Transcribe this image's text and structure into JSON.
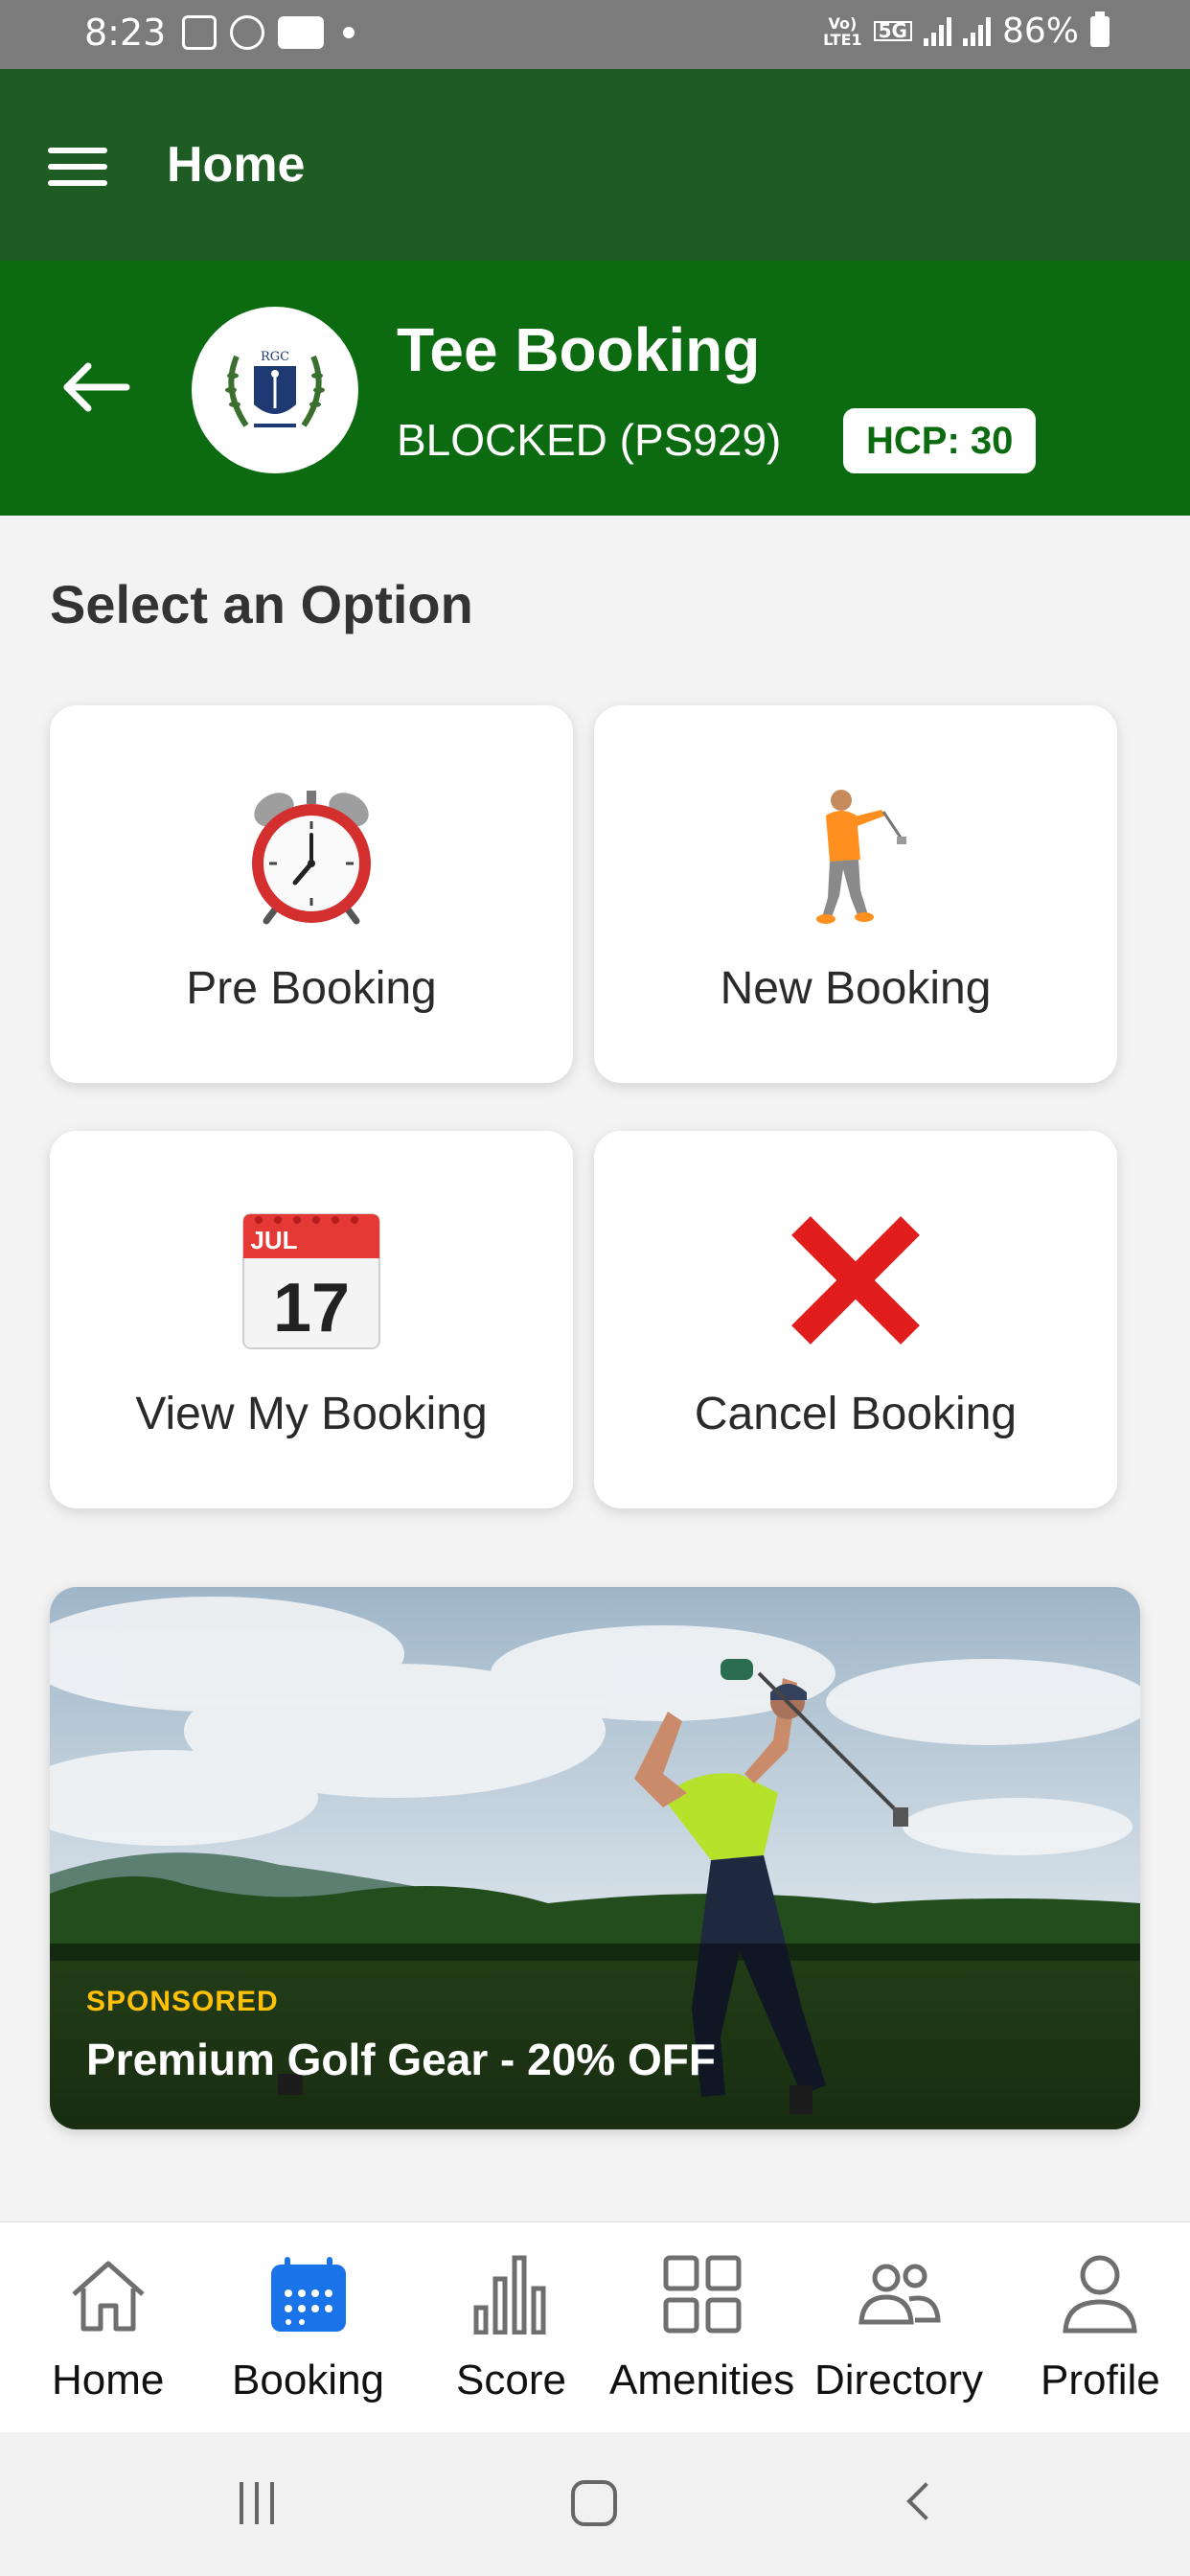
{
  "status_bar": {
    "time": "8:23",
    "network_top": "Vo)",
    "network_bottom": "LTE1",
    "network_type": "5G",
    "battery": "86%"
  },
  "app_bar": {
    "title": "Home"
  },
  "header": {
    "title": "Tee Booking",
    "status": "BLOCKED (PS929)",
    "hcp": "HCP: 30",
    "logo_text": "RGC"
  },
  "content": {
    "section_title": "Select an Option",
    "options": [
      {
        "label": "Pre Booking",
        "icon": "alarm-clock-icon"
      },
      {
        "label": "New Booking",
        "icon": "golfer-icon"
      },
      {
        "label": "View My Booking",
        "icon": "calendar-icon",
        "calendar_month": "JUL",
        "calendar_day": "17"
      },
      {
        "label": "Cancel Booking",
        "icon": "cross-mark-icon"
      }
    ],
    "banner": {
      "tag": "SPONSORED",
      "text": "Premium Golf Gear - 20% OFF"
    }
  },
  "bottom_nav": {
    "items": [
      {
        "label": "Home",
        "icon": "home-icon",
        "active": false
      },
      {
        "label": "Booking",
        "icon": "calendar-icon",
        "active": true
      },
      {
        "label": "Score",
        "icon": "bar-chart-icon",
        "active": false
      },
      {
        "label": "Amenities",
        "icon": "grid-icon",
        "active": false
      },
      {
        "label": "Directory",
        "icon": "people-icon",
        "active": false
      },
      {
        "label": "Profile",
        "icon": "person-icon",
        "active": false
      }
    ]
  },
  "colors": {
    "app_bar": "#1f5c24",
    "header": "#0c6a10",
    "active_nav": "#1a73e8",
    "sponsored": "#ffc107"
  }
}
